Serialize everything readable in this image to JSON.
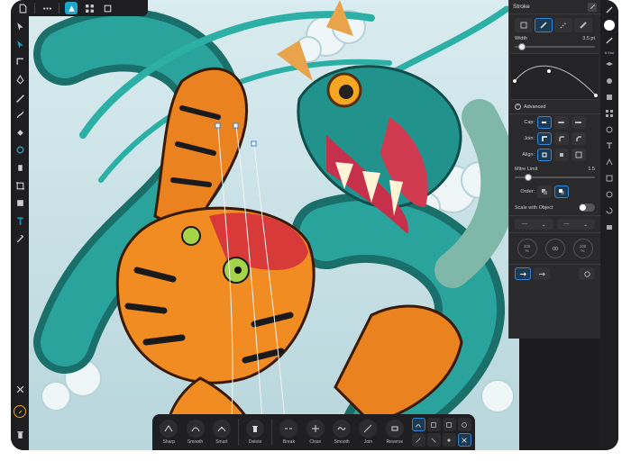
{
  "toolbar": {
    "icons": [
      "document-icon",
      "more-icon",
      "pixel-persona-icon",
      "grid-icon",
      "snapping-icon"
    ]
  },
  "left_tools": [
    "move-tool-icon",
    "node-tool-icon",
    "corner-tool-icon",
    "pen-tool-icon",
    "pencil-tool-icon",
    "vector-brush-icon",
    "fill-tool-icon",
    "transparency-tool-icon",
    "place-image-icon",
    "crop-tool-icon",
    "rectangle-tool-icon",
    "text-tool-icon",
    "color-picker-icon"
  ],
  "stroke_panel": {
    "title": "Stroke",
    "width_label": "Width",
    "width_value": "3.5 pt",
    "width_fraction": 0.04,
    "advanced_label": "Advanced",
    "cap_label": "Cap:",
    "join_label": "Join:",
    "align_label": "Align:",
    "mitre_label": "Mitre Limit",
    "mitre_value": "1.5",
    "mitre_fraction": 0.12,
    "order_label": "Order:",
    "scale_label": "Scale with Object",
    "dial1_value": "100",
    "dial1_unit": "%",
    "dial2_value": "100",
    "dial2_unit": "%"
  },
  "right_strip": {
    "label": "6 Mat"
  },
  "node_bar": {
    "items": [
      {
        "label": "Sharp",
        "icon": "sharp-node-icon"
      },
      {
        "label": "Smooth",
        "icon": "smooth-node-icon"
      },
      {
        "label": "Smart",
        "icon": "smart-node-icon"
      },
      {
        "label": "Delete",
        "icon": "delete-node-icon"
      },
      {
        "label": "Break",
        "icon": "break-curve-icon"
      },
      {
        "label": "Close",
        "icon": "close-curve-icon"
      },
      {
        "label": "Smooth",
        "icon": "smooth-curve-icon"
      },
      {
        "label": "Join",
        "icon": "join-curves-icon"
      },
      {
        "label": "Reverse",
        "icon": "reverse-curve-icon"
      }
    ]
  },
  "colors": {
    "accent": "#1fa5c9",
    "selection": "#2f86d8",
    "panel_bg": "#2a2a2c",
    "dragon": "#1e8f8a",
    "tiger": "#e9821f"
  }
}
